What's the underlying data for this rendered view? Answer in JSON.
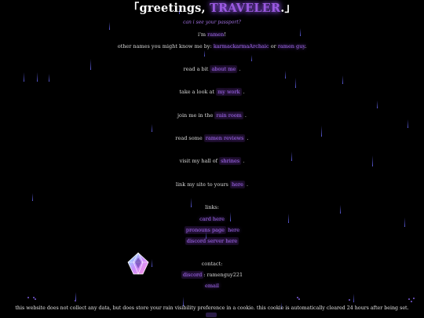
{
  "header": {
    "bracket_open": "「",
    "greeting": "greetings, ",
    "traveler": "TRAVELER",
    "punct": ".",
    "bracket_close": "」"
  },
  "passport_link": "can i see your passport?",
  "intro": {
    "im": "i'm ",
    "name": "ramen",
    "excl": "!"
  },
  "other_names": {
    "prefix": "other names you might know me by: ",
    "name1": "karmackarmaArchaic",
    "or": " or ",
    "name2": "ramen guy",
    "end": "."
  },
  "nav": [
    {
      "prefix": "read a bit ",
      "link": "about me",
      "suffix": " ."
    },
    {
      "prefix": "take a look at ",
      "link": "my work",
      "suffix": " ."
    },
    {
      "prefix": "join me in the ",
      "link": "rain room",
      "suffix": " ."
    },
    {
      "prefix": "read some ",
      "link": "ramen reviews",
      "suffix": " ."
    },
    {
      "prefix": "visit my hall of ",
      "link": "shrines",
      "suffix": " ."
    },
    {
      "prefix": "link my site to yours ",
      "link": "here",
      "suffix": " ."
    }
  ],
  "links": {
    "heading": "links:",
    "card": "card here",
    "pronouns_prefix": "pronouns page",
    "pronouns_link": " here",
    "discord": "discord server here"
  },
  "contact": {
    "heading": "contact:",
    "discord_label": "discord",
    "discord_value": ": ramenguy221",
    "email": "email"
  },
  "footer": "this website does not collect any data, but does store your rain visibility preference in a cookie. this cookie is automatically cleared 24 hours after being set.",
  "icons": {
    "crystal": "crystal-icon"
  },
  "colors": {
    "background": "#000000",
    "accent": "#9b5ae0",
    "rain": "#5a5ad8"
  }
}
